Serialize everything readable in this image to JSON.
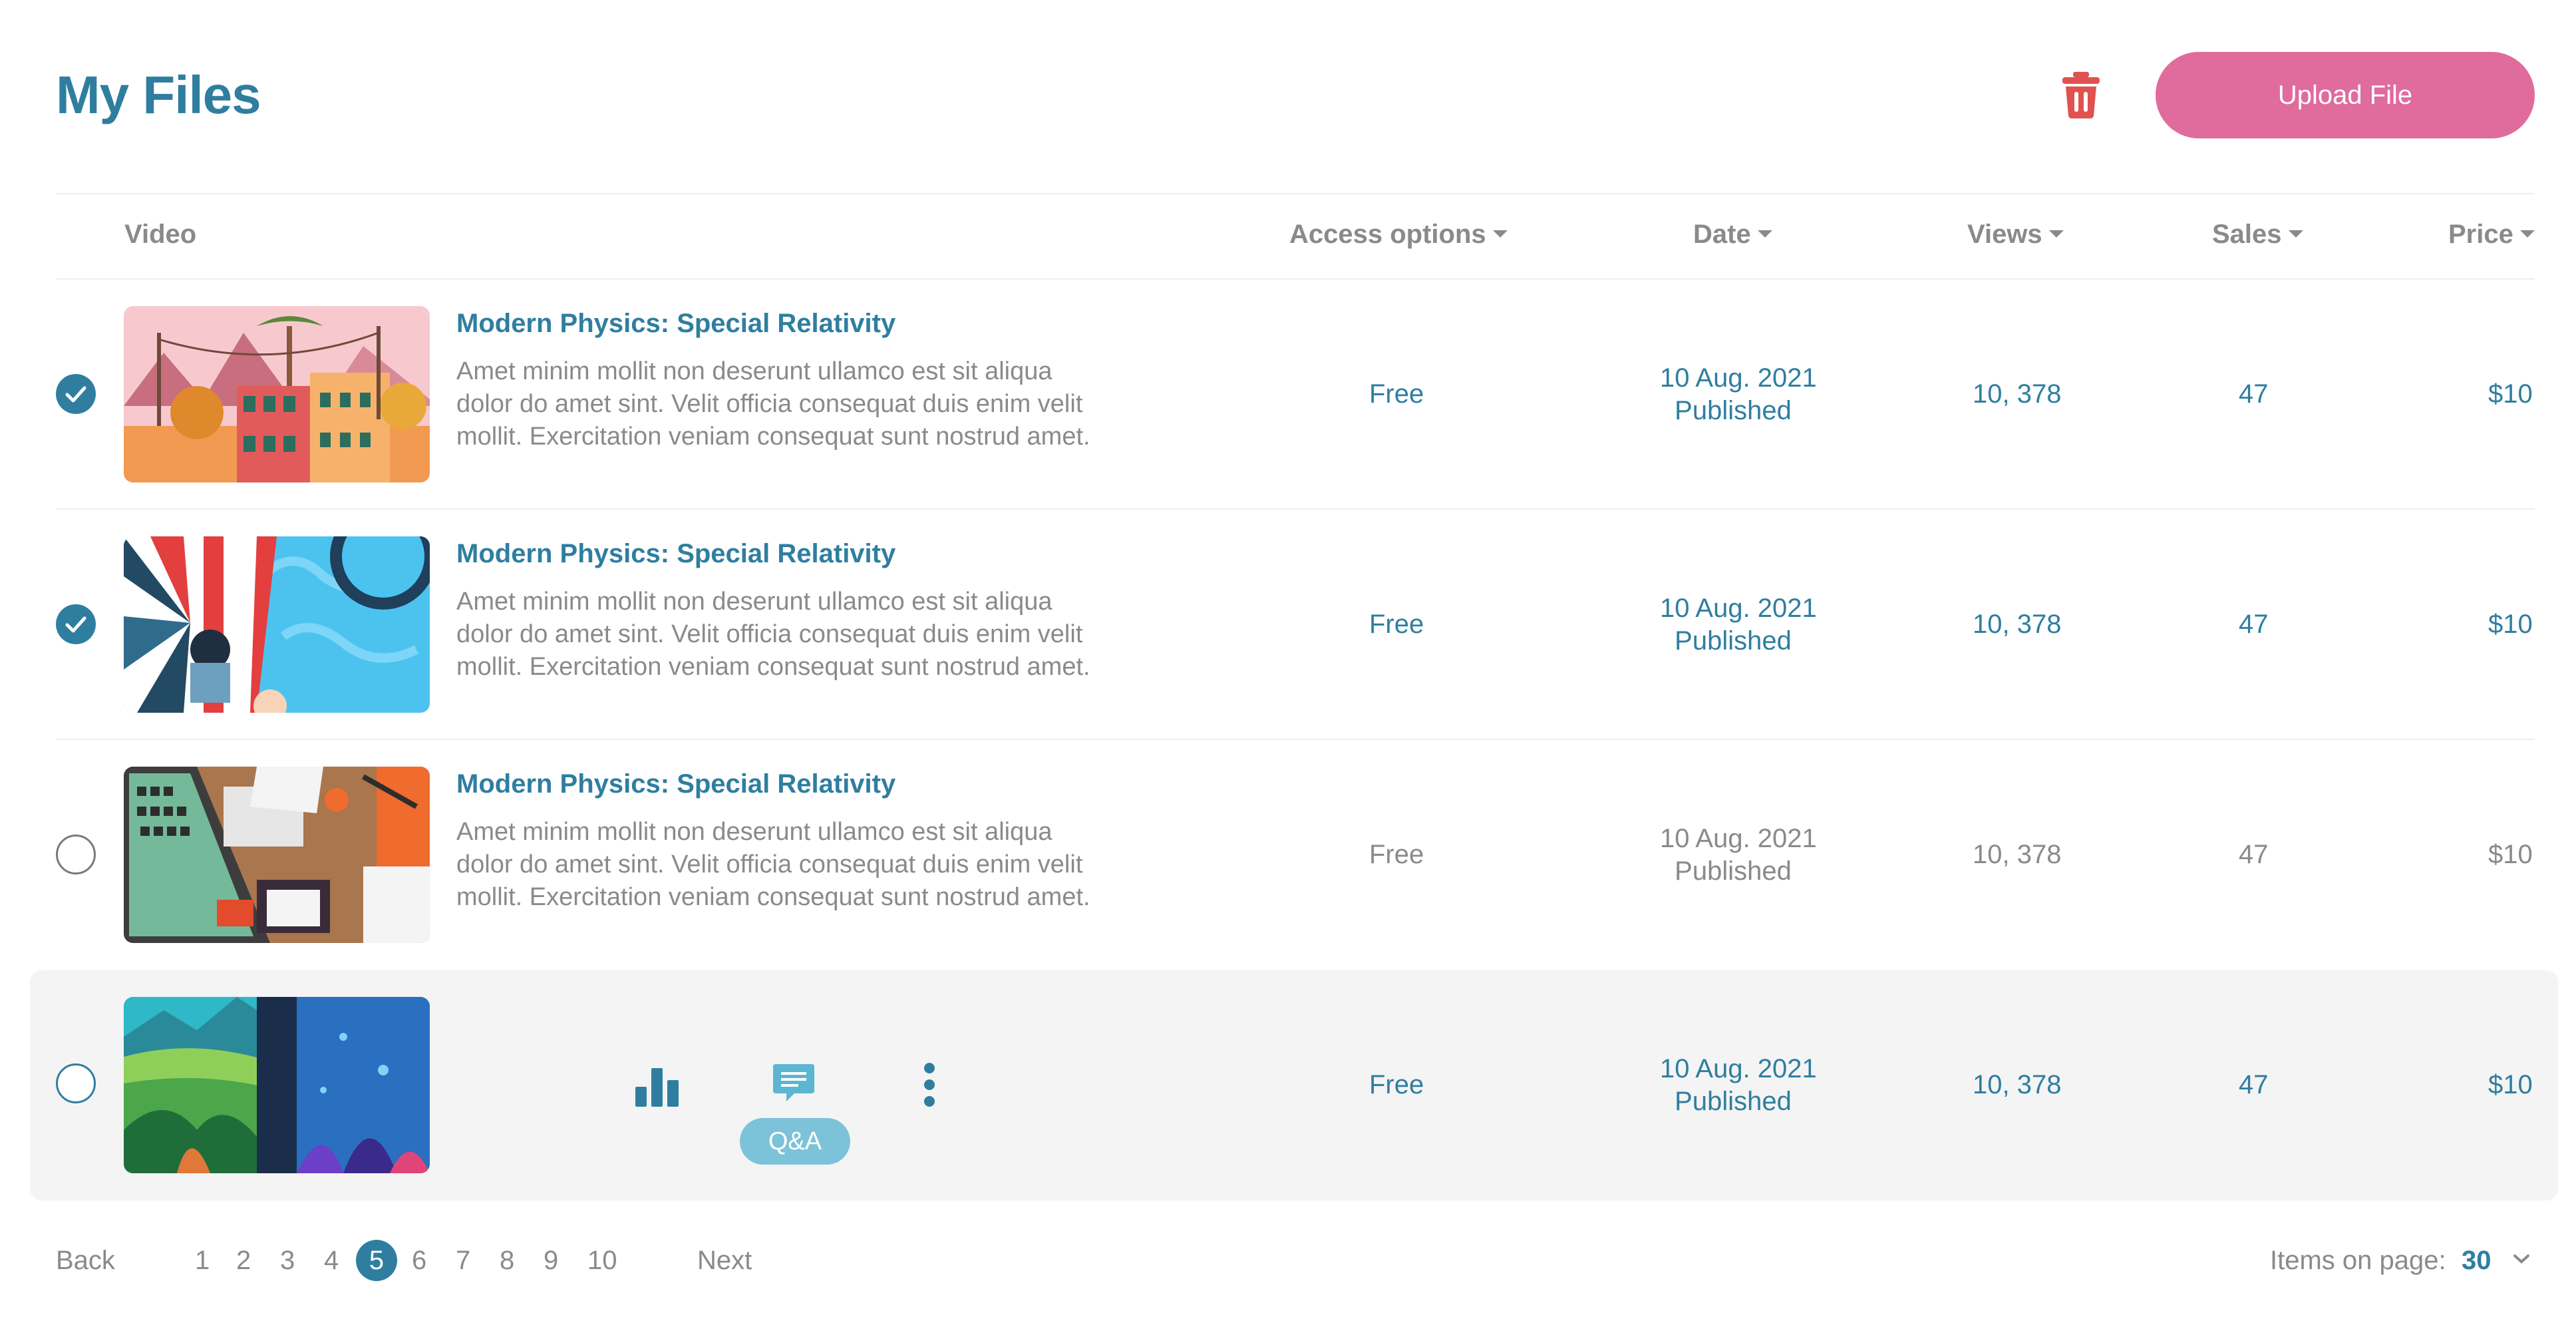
{
  "header": {
    "title": "My Files",
    "upload_label": "Upload File"
  },
  "table": {
    "columns": {
      "video": "Video",
      "access": "Access options",
      "date": "Date",
      "views": "Views",
      "sales": "Sales",
      "price": "Price"
    },
    "rows": [
      {
        "selected": true,
        "title": "Modern Physics: Special Relativity",
        "description": "Amet minim mollit non deserunt ullamco est sit aliqua dolor do amet sint. Velit officia consequat duis enim velit mollit. Exercitation veniam consequat sunt nostrud amet.",
        "access": "Free",
        "date": "10 Aug. 2021",
        "status": "Published",
        "views": "10, 378",
        "sales": "47",
        "price": "$10"
      },
      {
        "selected": true,
        "title": "Modern Physics: Special Relativity",
        "description": "Amet minim mollit non deserunt ullamco est sit aliqua dolor do amet sint. Velit officia consequat duis enim velit mollit. Exercitation veniam consequat sunt nostrud amet.",
        "access": "Free",
        "date": "10 Aug. 2021",
        "status": "Published",
        "views": "10, 378",
        "sales": "47",
        "price": "$10"
      },
      {
        "selected": false,
        "title": "Modern Physics: Special Relativity",
        "description": "Amet minim mollit non deserunt ullamco est sit aliqua dolor do amet sint. Velit officia consequat duis enim velit mollit. Exercitation veniam consequat sunt nostrud amet.",
        "access": "Free",
        "date": "10 Aug. 2021",
        "status": "Published",
        "views": "10, 378",
        "sales": "47",
        "price": "$10"
      },
      {
        "selected": false,
        "hovered": true,
        "qa_label": "Q&A",
        "access": "Free",
        "date": "10 Aug. 2021",
        "status": "Published",
        "views": "10, 378",
        "sales": "47",
        "price": "$10"
      }
    ]
  },
  "pagination": {
    "back": "Back",
    "next": "Next",
    "pages": [
      "1",
      "2",
      "3",
      "4",
      "5",
      "6",
      "7",
      "8",
      "9",
      "10"
    ],
    "current": "5",
    "items_label": "Items on page:",
    "items_value": "30"
  },
  "colors": {
    "accent": "#2f7ea0",
    "upload": "#e06b9d",
    "delete": "#e0524f",
    "qa": "#7cc3d9"
  }
}
